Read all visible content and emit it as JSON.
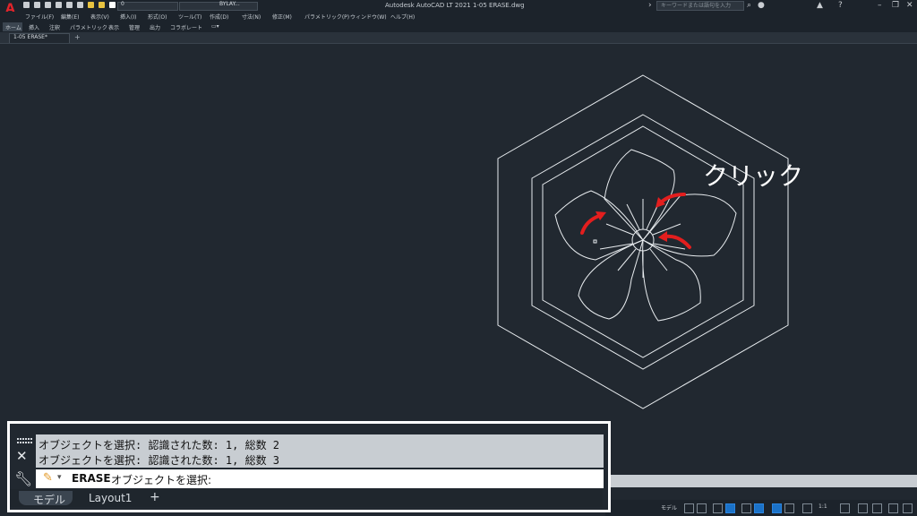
{
  "app": {
    "title": "Autodesk AutoCAD LT 2021    1-05 ERASE.dwg",
    "search_placeholder": "キーワードまたは語句を入力"
  },
  "toolbar": {
    "layer_value": "0",
    "linetype_value": "BYLAY..."
  },
  "menu": [
    "ファイル(F)",
    "編集(E)",
    "表示(V)",
    "挿入(I)",
    "形式(O)",
    "ツール(T)",
    "作成(D)",
    "寸法(N)",
    "修正(M)",
    "パラメトリック(P)",
    "ウィンドウ(W)",
    "ヘルプ(H)"
  ],
  "ribbon_tabs": [
    "ホーム",
    "挿入",
    "注釈",
    "パラメトリック",
    "表示",
    "管理",
    "出力",
    "コラボレート"
  ],
  "document_tab": "1-05 ERASE*",
  "annotation": "クリック",
  "command": {
    "history": [
      "オブジェクトを選択: 認識された数: 1, 総数 2",
      "オブジェクトを選択: 認識された数: 1, 総数 3"
    ],
    "keyword": "ERASE",
    "prompt": "オブジェクトを選択:"
  },
  "layout_tabs": [
    "モデル",
    "Layout1"
  ],
  "status": {
    "space": "モデル",
    "scale": "1:1"
  },
  "colors": {
    "canvas": "#212830",
    "arrows": "#e31e1e",
    "lines": "#e8ecef"
  }
}
